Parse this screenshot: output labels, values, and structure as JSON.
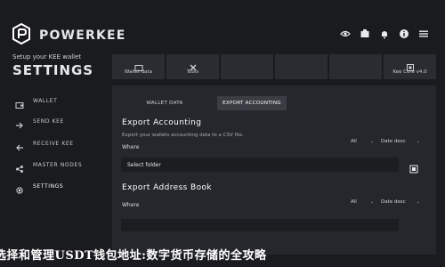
{
  "brand": {
    "name": "POWERKEE"
  },
  "subtitle": "Setup your KEE wallet",
  "settings_title": "SETTINGS",
  "top_icons": [
    "eye-icon",
    "settings-icon",
    "bell-icon",
    "info-icon",
    "menu-icon"
  ],
  "sidebar": {
    "items": [
      {
        "label": "WALLET",
        "icon": "wallet-icon"
      },
      {
        "label": "SEND KEE",
        "icon": "send-icon"
      },
      {
        "label": "RECEIVE KEE",
        "icon": "receive-icon"
      },
      {
        "label": "MASTER NODES",
        "icon": "nodes-icon"
      },
      {
        "label": "SETTINGS",
        "icon": "gear-icon"
      }
    ]
  },
  "tabs": [
    {
      "label": "Wallet data"
    },
    {
      "label": "Tools"
    },
    {
      "label": ""
    },
    {
      "label": ""
    },
    {
      "label": ""
    },
    {
      "label": "Kee Core v4.0"
    }
  ],
  "sub_tabs": [
    {
      "label": "WALLET DATA"
    },
    {
      "label": "EXPORT ACCOUNTING"
    }
  ],
  "export_accounting": {
    "title": "Export Accounting",
    "description": "Export your wallets accounting data to a CSV file.",
    "where_label": "Where",
    "filter_all": "All",
    "filter_date": "Date desc",
    "folder_placeholder": "Select folder"
  },
  "export_address_book": {
    "title": "Export Address Book",
    "where_label": "Where",
    "filter_all": "All",
    "filter_date": "Date desc"
  },
  "overlay_text": "选择和管理USDT钱包地址:数字货币存储的全攻略"
}
